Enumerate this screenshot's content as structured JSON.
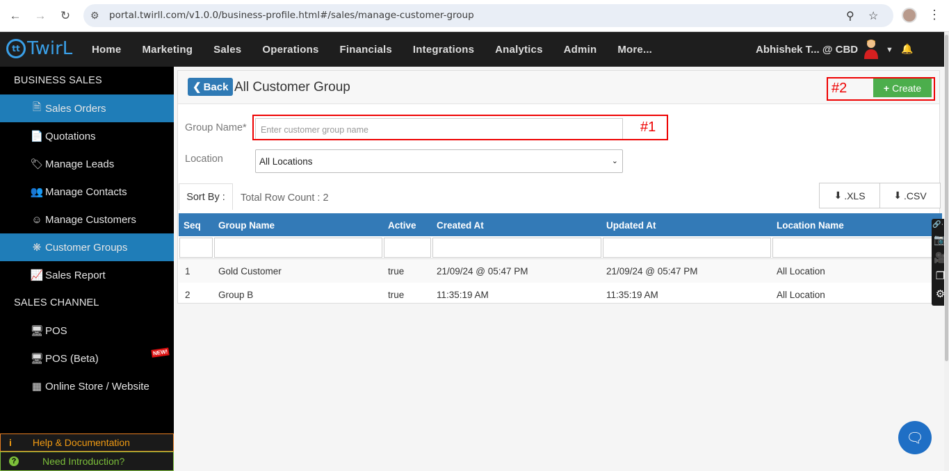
{
  "browser": {
    "url": "portal.twirll.com/v1.0.0/business-profile.html#/sales/manage-customer-group"
  },
  "topnav": {
    "logo": "Twir",
    "logo_suffix": "L",
    "menu": [
      "Home",
      "Marketing",
      "Sales",
      "Operations",
      "Financials",
      "Integrations",
      "Analytics",
      "Admin",
      "More..."
    ],
    "user": "Abhishek T...  @ CBD"
  },
  "sidebar": {
    "section1": "BUSINESS SALES",
    "items1": [
      {
        "label": "Sales Orders",
        "icon": "document-icon"
      },
      {
        "label": "Quotations",
        "icon": "file-icon"
      },
      {
        "label": "Manage Leads",
        "icon": "tags-icon"
      },
      {
        "label": "Manage Contacts",
        "icon": "users-icon"
      },
      {
        "label": "Manage Customers",
        "icon": "user-circle-icon"
      },
      {
        "label": "Customer Groups",
        "icon": "group-icon"
      },
      {
        "label": "Sales Report",
        "icon": "chart-icon"
      }
    ],
    "section2": "SALES CHANNEL",
    "items2": [
      {
        "label": "POS",
        "icon": "monitor-icon"
      },
      {
        "label": "POS (Beta)",
        "icon": "monitor-icon",
        "badge": "NEW!"
      },
      {
        "label": "Online Store / Website",
        "icon": "store-icon"
      }
    ],
    "help": "Help & Documentation",
    "intro": "Need Introduction?"
  },
  "page": {
    "back_label": "Back",
    "title": "All Customer Group",
    "create_label": "Create",
    "annot1": "#1",
    "annot2": "#2",
    "group_label": "Group Name*",
    "group_placeholder": "Enter customer group name",
    "location_label": "Location",
    "location_value": "All Locations",
    "sort_label": "Sort By :",
    "row_count": "Total Row Count : 2",
    "xls": ".XLS",
    "csv": ".CSV"
  },
  "table": {
    "headers": [
      "Seq",
      "Group Name",
      "Active",
      "Created At",
      "Updated At",
      "Location Name"
    ],
    "rows": [
      [
        "1",
        "Gold Customer",
        "true",
        "21/09/24 @ 05:47 PM",
        "21/09/24 @ 05:47 PM",
        "All Location"
      ],
      [
        "2",
        "Group B",
        "true",
        "11:35:19 AM",
        "11:35:19 AM",
        "All Location"
      ]
    ]
  },
  "colors": {
    "accent": "#337ab7",
    "sidebar_active": "#1f7db8",
    "create": "#4cae4c",
    "annotation": "#e00000"
  }
}
